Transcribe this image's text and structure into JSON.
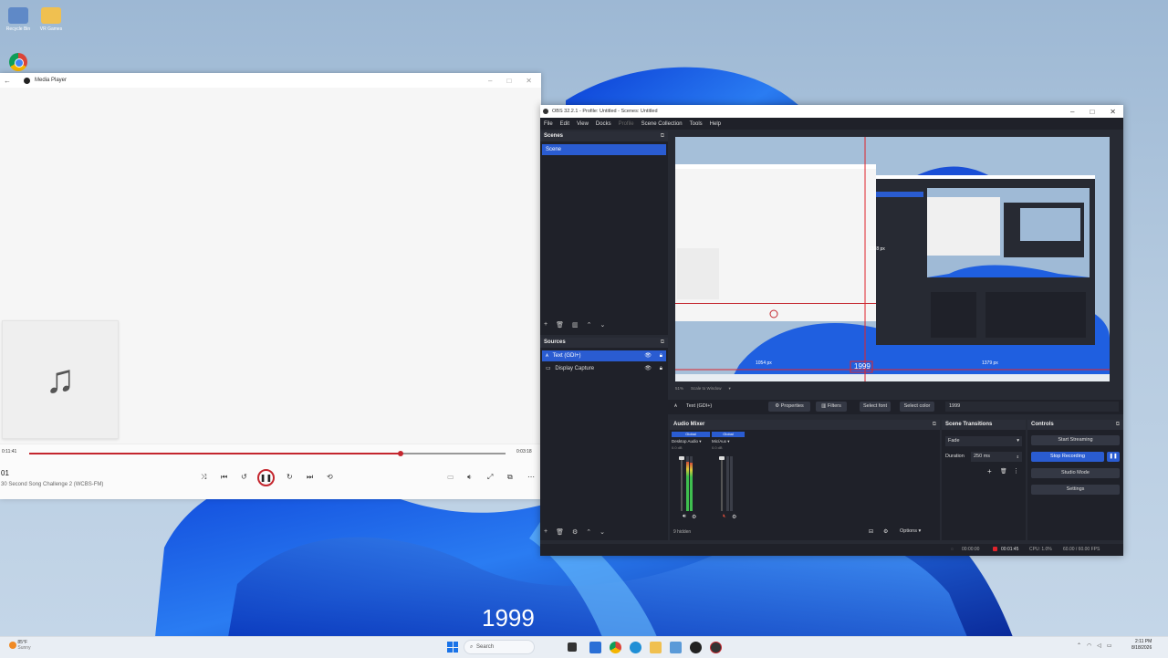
{
  "desktop": {
    "icons": [
      {
        "label": "Recycle Bin",
        "color": "#5f89c7"
      },
      {
        "label": "VR Games",
        "color": "#f0c050"
      }
    ],
    "overlay_text": "1999"
  },
  "media_player": {
    "title": "Media Player",
    "elapsed": "0:11:41",
    "total": "0:03:18",
    "progress": 0.78,
    "track_number": "01",
    "track_title": "30 Second Song Challenge 2 (WCBS-FM)",
    "accent": "#c4262e"
  },
  "obs": {
    "title": "OBS 32.2.1 - Profile: Untitled - Scenes: Untitled",
    "menu": [
      "File",
      "Edit",
      "View",
      "Docks",
      "Profile",
      "Scene Collection",
      "Tools",
      "Help"
    ],
    "scenes_header": "Scenes",
    "scenes": [
      "Scene"
    ],
    "sources_header": "Sources",
    "sources": [
      "Text (GDI+)",
      "Display Capture"
    ],
    "preview": {
      "measure_left": "1054 px",
      "measure_right": "1379 px",
      "measure_top": "1328 px",
      "text_label": "1999",
      "zoom_label": "51%",
      "scale_label": "Scale to Window"
    },
    "source_toolbar": {
      "selected_source": "Text (GDI+)",
      "properties": "Properties",
      "filters": "Filters",
      "select_font": "Select font",
      "select_color": "Select color",
      "text_value": "1999"
    },
    "audio_mixer": {
      "header": "Audio Mixer",
      "channels": [
        {
          "badge": "Global",
          "name": "Desktop Audio",
          "db": "0.0 dB"
        },
        {
          "badge": "Global",
          "name": "Mic/Aux",
          "db": "0.0 dB"
        }
      ],
      "hidden": "9 hidden",
      "options": "Options"
    },
    "transitions": {
      "header": "Scene Transitions",
      "type": "Fade",
      "duration_label": "Duration",
      "duration_value": "250 ms"
    },
    "controls": {
      "header": "Controls",
      "start_streaming": "Start Streaming",
      "stop_recording": "Stop Recording",
      "studio_mode": "Studio Mode",
      "settings": "Settings"
    },
    "status": {
      "stream_time": "00:00:00",
      "rec_time": "00:01:45",
      "cpu": "CPU: 1.0%",
      "fps": "60.00 / 60.00 FPS"
    }
  },
  "taskbar": {
    "weather_temp": "85°F",
    "weather_text": "Sunny",
    "search_placeholder": "Search",
    "time": "2:11 PM",
    "date": "8/18/2026"
  }
}
